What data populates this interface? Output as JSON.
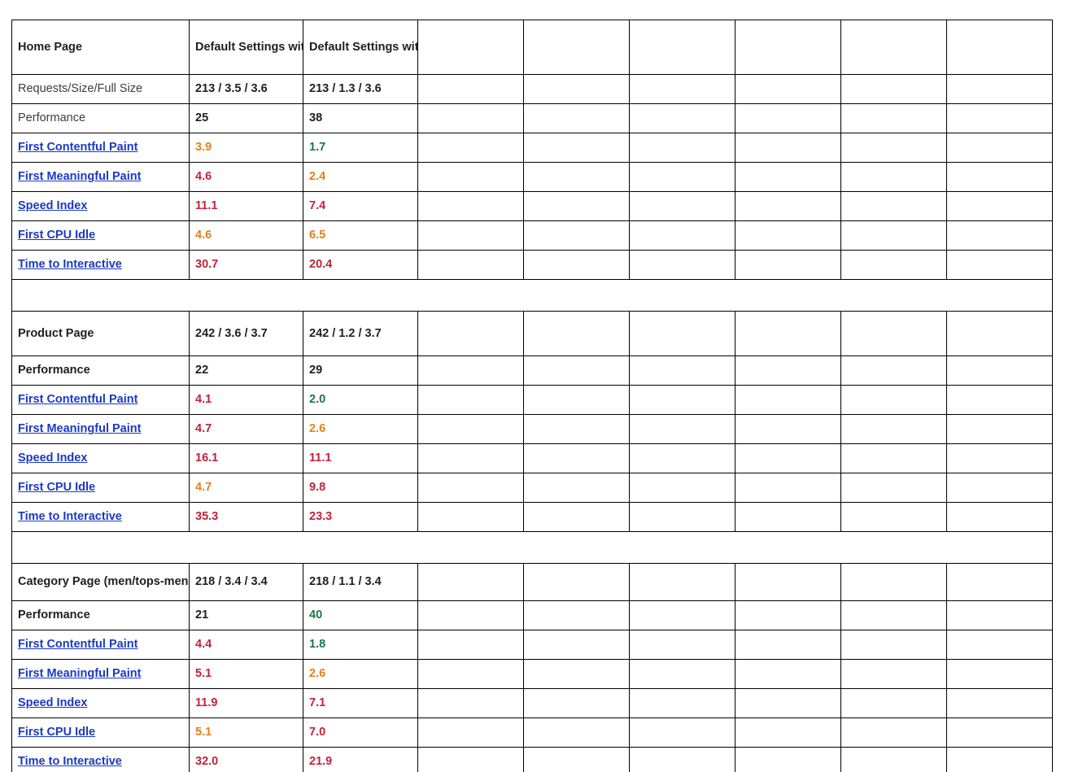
{
  "table": {
    "column_headers": [
      "",
      "Default Settings without  gzip",
      "Default Settings with gzip",
      "",
      "",
      "",
      "",
      "",
      ""
    ],
    "blank_column_count": 6,
    "colors": {
      "good": "#1d7544",
      "warn": "#e08214",
      "bad": "#c2223a",
      "neutral": "#1f1f1f",
      "link": "#1a39c4",
      "border": "#000000"
    },
    "sections": [
      {
        "id": "home-page",
        "title": "Home Page",
        "col1_header": "Default Settings without  gzip",
        "col2_header": "Default Settings with gzip",
        "rows": [
          {
            "label": "Requests/Size/Full Size",
            "label_style": "plain",
            "v1": "213 / 3.5 / 3.6",
            "v1_state": "neutral",
            "v2": "213 / 1.3 / 3.6",
            "v2_state": "neutral"
          },
          {
            "label": "Performance",
            "label_style": "plain",
            "v1": "25",
            "v1_state": "neutral",
            "v2": "38",
            "v2_state": "neutral"
          },
          {
            "label": "First Contentful Paint",
            "label_style": "link",
            "v1": "3.9",
            "v1_state": "warn",
            "v2": "1.7",
            "v2_state": "good"
          },
          {
            "label": "First Meaningful Paint",
            "label_style": "link",
            "v1": "4.6",
            "v1_state": "bad",
            "v2": "2.4",
            "v2_state": "warn"
          },
          {
            "label": "Speed Index",
            "label_style": "link",
            "v1": "11.1",
            "v1_state": "bad",
            "v2": "7.4",
            "v2_state": "bad"
          },
          {
            "label": "First CPU Idle",
            "label_style": "link",
            "v1": "4.6",
            "v1_state": "warn",
            "v2": "6.5",
            "v2_state": "warn"
          },
          {
            "label": "Time to Interactive",
            "label_style": "link",
            "v1": "30.7",
            "v1_state": "bad",
            "v2": "20.4",
            "v2_state": "bad"
          }
        ]
      },
      {
        "id": "product-page",
        "title": "Product Page",
        "title_v1": "242 / 3.6 / 3.7",
        "title_v2": "242 / 1.2 / 3.7",
        "rows": [
          {
            "label": "Performance",
            "label_style": "bold",
            "v1": "22",
            "v1_state": "neutral",
            "v2": "29",
            "v2_state": "neutral"
          },
          {
            "label": "First Contentful Paint",
            "label_style": "link",
            "v1": "4.1",
            "v1_state": "bad",
            "v2": "2.0",
            "v2_state": "good"
          },
          {
            "label": "First Meaningful Paint",
            "label_style": "link",
            "v1": "4.7",
            "v1_state": "bad",
            "v2": "2.6",
            "v2_state": "warn"
          },
          {
            "label": "Speed Index",
            "label_style": "link",
            "v1": "16.1",
            "v1_state": "bad",
            "v2": "11.1",
            "v2_state": "bad"
          },
          {
            "label": "First CPU Idle",
            "label_style": "link",
            "v1": "4.7",
            "v1_state": "warn",
            "v2": "9.8",
            "v2_state": "bad"
          },
          {
            "label": "Time to Interactive",
            "label_style": "link",
            "v1": "35.3",
            "v1_state": "bad",
            "v2": "23.3",
            "v2_state": "bad"
          }
        ]
      },
      {
        "id": "category-page",
        "title": "Category Page (men/tops-men.html)",
        "title_v1": "218 / 3.4 / 3.4",
        "title_v2": "218 / 1.1 / 3.4",
        "rows": [
          {
            "label": "Performance",
            "label_style": "bold",
            "v1": "21",
            "v1_state": "neutral",
            "v2": "40",
            "v2_state": "good"
          },
          {
            "label": "First Contentful Paint",
            "label_style": "link",
            "v1": "4.4",
            "v1_state": "bad",
            "v2": "1.8",
            "v2_state": "good"
          },
          {
            "label": "First Meaningful Paint",
            "label_style": "link",
            "v1": "5.1",
            "v1_state": "bad",
            "v2": "2.6",
            "v2_state": "warn"
          },
          {
            "label": "Speed Index",
            "label_style": "link",
            "v1": "11.9",
            "v1_state": "bad",
            "v2": "7.1",
            "v2_state": "bad"
          },
          {
            "label": "First CPU Idle",
            "label_style": "link",
            "v1": "5.1",
            "v1_state": "warn",
            "v2": "7.0",
            "v2_state": "bad"
          },
          {
            "label": "Time to Interactive",
            "label_style": "link",
            "v1": "32.0",
            "v1_state": "bad",
            "v2": "21.9",
            "v2_state": "bad"
          }
        ]
      }
    ]
  }
}
